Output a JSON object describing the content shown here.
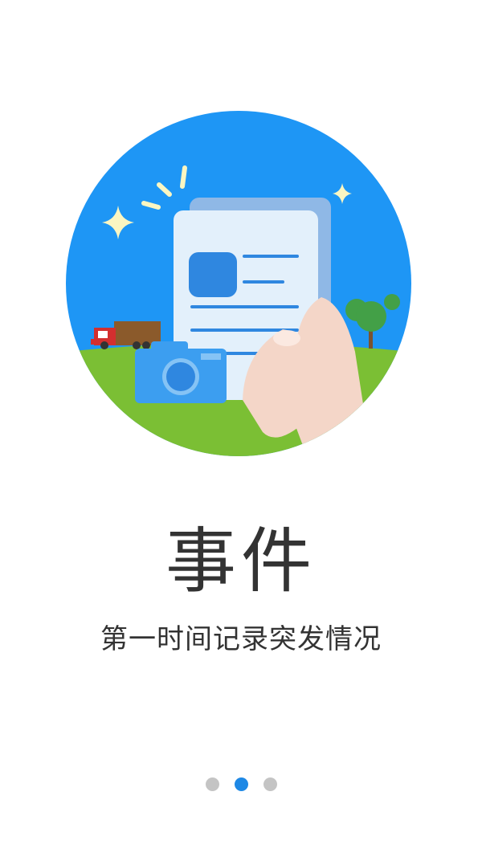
{
  "onboarding": {
    "title": "事件",
    "subtitle": "第一时间记录突发情况",
    "pager": {
      "total": 3,
      "active_index": 1,
      "active_color": "#1e88e5",
      "inactive_color": "#c4c4c4"
    }
  },
  "colors": {
    "sky": "#1e96f5",
    "grass": "#7bbf34",
    "card": "#e3f0fb",
    "card_back": "#8fb8e6",
    "accent_blue": "#2f87e0",
    "camera": "#3c9ef0",
    "hand": "#f4d6c8",
    "sparkle": "#fbf6c2"
  }
}
